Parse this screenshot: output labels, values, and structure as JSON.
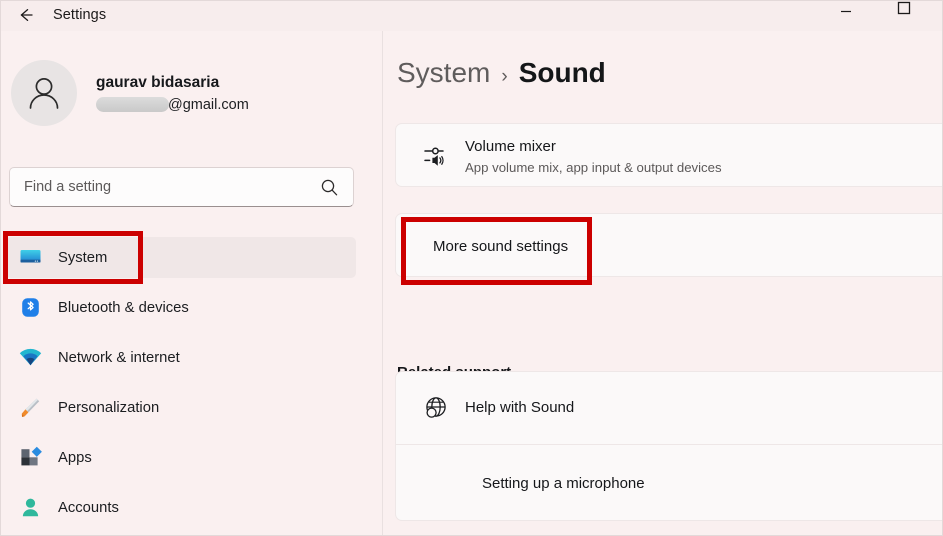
{
  "window": {
    "title": "Settings",
    "back_icon": "back-arrow-icon",
    "minimize_label": "—",
    "maximize_label": "□"
  },
  "sidebar": {
    "profile": {
      "name": "gaurav bidasaria",
      "email_suffix": "@gmail.com",
      "email_redacted": true,
      "avatar_icon": "person-avatar-icon"
    },
    "search": {
      "placeholder": "Find a setting",
      "value": "",
      "icon": "search-icon"
    },
    "items": [
      {
        "label": "System",
        "icon": "monitor-icon",
        "selected": true
      },
      {
        "label": "Bluetooth & devices",
        "icon": "bluetooth-icon",
        "selected": false
      },
      {
        "label": "Network & internet",
        "icon": "wifi-icon",
        "selected": false
      },
      {
        "label": "Personalization",
        "icon": "paintbrush-icon",
        "selected": false
      },
      {
        "label": "Apps",
        "icon": "apps-icon",
        "selected": false
      },
      {
        "label": "Accounts",
        "icon": "account-icon",
        "selected": false
      }
    ]
  },
  "main": {
    "breadcrumb": {
      "parent": "System",
      "separator": "›",
      "current": "Sound"
    },
    "cards": {
      "volume_mixer": {
        "title": "Volume mixer",
        "subtitle": "App volume mix, app input & output devices",
        "icon": "volume-mixer-icon",
        "trailing_icon": "chevron-right-icon"
      },
      "more_sound_settings": {
        "title": "More sound settings",
        "trailing_icon": "external-link-icon"
      }
    },
    "related_support": {
      "heading": "Related support",
      "help_title": "Help with Sound",
      "help_icon": "globe-help-icon",
      "expand_icon": "chevron-up-icon",
      "links": [
        "Setting up a microphone"
      ]
    }
  },
  "annotations": {
    "color": "#cc0000",
    "boxes": [
      {
        "target": "sidebar-item-system"
      },
      {
        "target": "more-sound-settings-row"
      }
    ]
  }
}
